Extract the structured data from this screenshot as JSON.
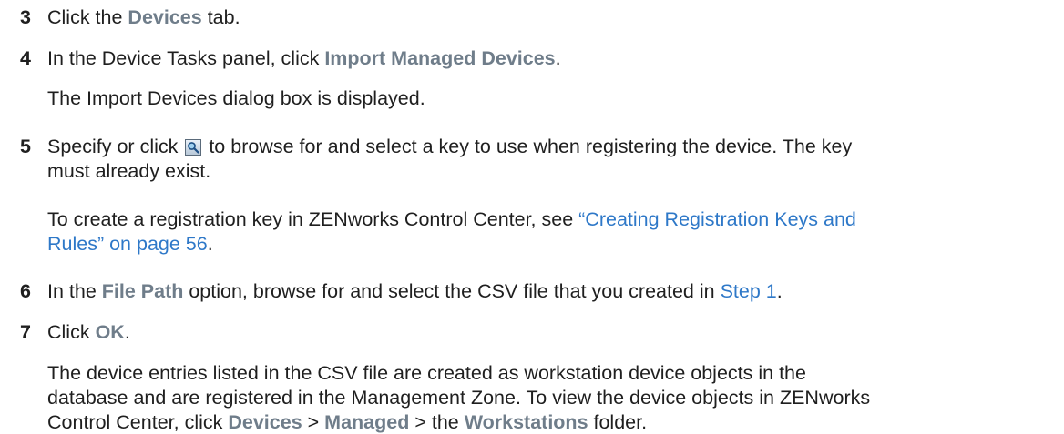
{
  "steps": [
    {
      "num": "3",
      "pre": "Click the ",
      "ui": "Devices",
      "post": " tab."
    },
    {
      "num": "4",
      "pre": "In the Device Tasks panel, click ",
      "ui": "Import Managed Devices",
      "post": "."
    },
    {
      "note": "The Import Devices dialog box is displayed."
    },
    {
      "num": "5",
      "pre": "Specify or click ",
      "icon": "search-icon",
      "post": " to browse for and select a key to use when registering the device. The key",
      "cont": "must already exist."
    },
    {
      "note2_pre": "To create a registration key in ZENworks Control Center, see ",
      "link1": "“Creating Registration Keys and",
      "link2": "Rules” on page 56",
      "note2_post": "."
    },
    {
      "num": "6",
      "pre": "In the ",
      "ui": "File Path",
      "mid": " option, browse for and select the CSV file that you created in ",
      "link": "Step 1",
      "post": "."
    },
    {
      "num": "7",
      "pre": "Click ",
      "ui": "OK",
      "post": "."
    },
    {
      "p1": "The device entries listed in the CSV file are created as workstation device objects in the",
      "p2": "database and are registered in the Management Zone. To view the device objects in ZENworks",
      "p3_pre": "Control Center, click ",
      "ui1": "Devices",
      "sep1": " > ",
      "ui2": "Managed",
      "sep2": " > the ",
      "ui3": "Workstations",
      "p3_post": " folder."
    }
  ]
}
